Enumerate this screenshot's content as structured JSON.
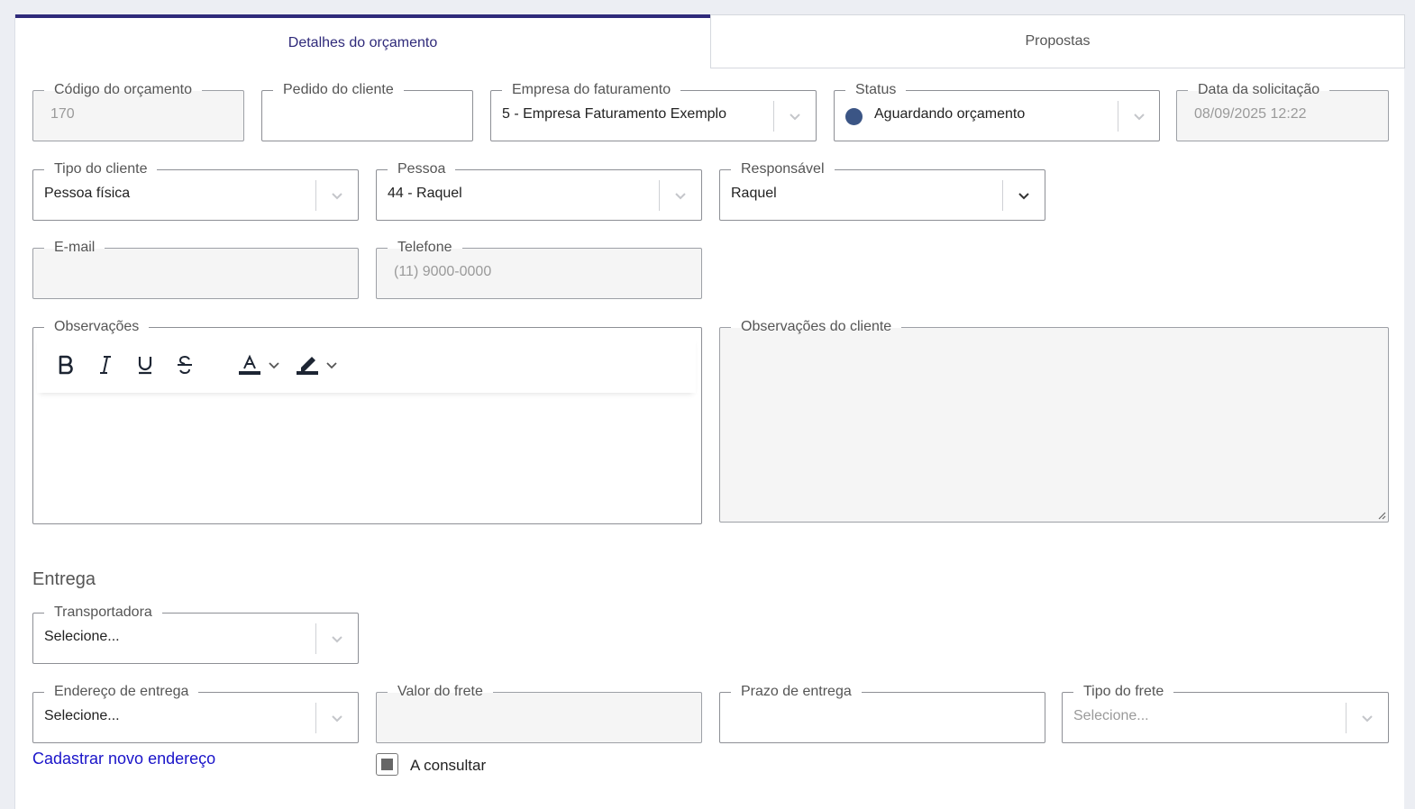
{
  "tabs": [
    {
      "label": "Detalhes do orçamento"
    },
    {
      "label": "Propostas"
    }
  ],
  "fields": {
    "codigo": {
      "label": "Código do orçamento",
      "value": "170"
    },
    "pedido": {
      "label": "Pedido do cliente",
      "value": ""
    },
    "empresa": {
      "label": "Empresa do faturamento",
      "value": "5 - Empresa Faturamento Exemplo"
    },
    "status": {
      "label": "Status",
      "value": "Aguardando orçamento",
      "dot_color": "#3b5585"
    },
    "data": {
      "label": "Data da solicitação",
      "value": "08/09/2025 12:22"
    },
    "tipo_cliente": {
      "label": "Tipo do cliente",
      "value": "Pessoa física"
    },
    "pessoa": {
      "label": "Pessoa",
      "value": "44 - Raquel"
    },
    "responsavel": {
      "label": "Responsável",
      "value": "Raquel"
    },
    "email": {
      "label": "E-mail",
      "value": ""
    },
    "telefone": {
      "label": "Telefone",
      "placeholder": "(11) 9000-0000"
    },
    "observacoes": {
      "label": "Observações"
    },
    "obs_cliente": {
      "label": "Observações do cliente"
    }
  },
  "toolbar": {
    "icons": [
      "bold-icon",
      "italic-icon",
      "underline-icon",
      "strikethrough-icon",
      "font-color-icon",
      "highlight-icon"
    ]
  },
  "entrega": {
    "title": "Entrega",
    "transportadora": {
      "label": "Transportadora",
      "value": "Selecione..."
    },
    "endereco": {
      "label": "Endereço de entrega",
      "value": "Selecione..."
    },
    "valor_frete": {
      "label": "Valor do frete",
      "value": ""
    },
    "prazo": {
      "label": "Prazo de entrega",
      "value": ""
    },
    "tipo_frete": {
      "label": "Tipo do frete",
      "value": "Selecione..."
    },
    "novo_endereco_link": "Cadastrar novo endereço",
    "a_consultar_label": "A consultar",
    "a_consultar_checked": true
  },
  "colors": {
    "accent": "#2f2a7a",
    "link": "#1a14c9",
    "border": "#8d8f95"
  }
}
